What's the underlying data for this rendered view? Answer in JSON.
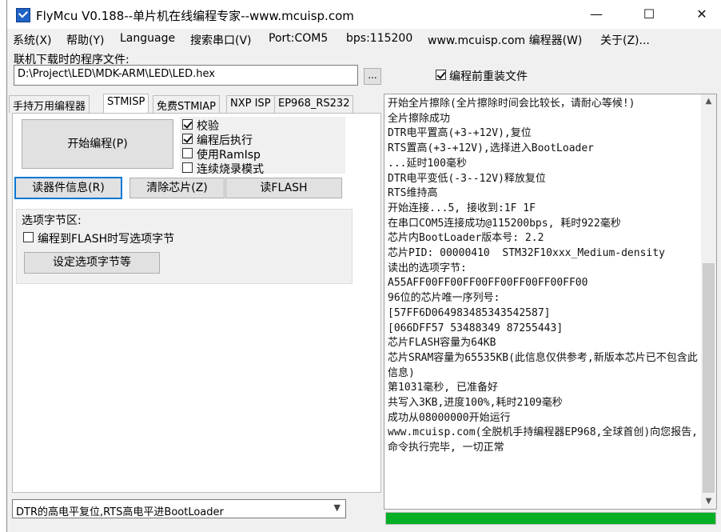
{
  "titlebar": {
    "title": "FlyMcu V0.188--单片机在线编程专家--www.mcuisp.com",
    "minimize": "—",
    "maximize": "☐",
    "close": "✕"
  },
  "menu": [
    "系统(X)",
    "帮助(Y)",
    "Language",
    "搜索串口(V)",
    "Port:COM5",
    "bps:115200",
    "www.mcuisp.com 编程器(W)",
    "关于(Z)..."
  ],
  "file": {
    "label": "联机下载时的程序文件:",
    "path": "D:\\Project\\LED\\MDK-ARM\\LED\\LED.hex",
    "browse": "...",
    "reload_label": "编程前重装文件",
    "reload_checked": true
  },
  "tabs": [
    "手持万用编程器",
    "STMISP",
    "免费STMIAP",
    "NXP ISP",
    "EP968_RS232"
  ],
  "stmisp": {
    "start_button": "开始编程(P)",
    "options": [
      {
        "label": "校验",
        "checked": true
      },
      {
        "label": "编程后执行",
        "checked": true
      },
      {
        "label": "使用RamIsp",
        "checked": false
      },
      {
        "label": "连续烧录模式",
        "checked": false
      }
    ],
    "read_info_button": "读器件信息(R)",
    "erase_button": "清除芯片(Z)",
    "read_flash_button": "读FLASH",
    "option_bytes": {
      "title": "选项字节区:",
      "write_label": "编程到FLASH时写选项字节",
      "write_checked": false,
      "set_button": "设定选项字节等"
    }
  },
  "log": [
    "开始全片擦除(全片擦除时间会比较长，请耐心等候!)",
    "全片擦除成功",
    "DTR电平置高(+3-+12V),复位",
    "RTS置高(+3-+12V),选择进入BootLoader",
    "...延时100毫秒",
    "DTR电平变低(-3--12V)释放复位",
    "RTS维持高",
    "开始连接...5, 接收到:1F 1F",
    "在串口COM5连接成功@115200bps, 耗时922毫秒",
    "芯片内BootLoader版本号: 2.2",
    "芯片PID: 00000410  STM32F10xxx_Medium-density",
    "读出的选项字节:",
    "A55AFF00FF00FF00FF00FF00FF00FF00",
    "96位的芯片唯一序列号:",
    "[57FF6D064983485343542587]",
    "[066DFF57 53488349 87255443]",
    "芯片FLASH容量为64KB",
    "芯片SRAM容量为65535KB(此信息仅供参考,新版本芯片已不包含此信息)",
    "第1031毫秒, 已准备好",
    "共写入3KB,进度100%,耗时2109毫秒",
    "成功从08000000开始运行",
    "www.mcuisp.com(全脱机手持编程器EP968,全球首创)向您报告, 命令执行完毕, 一切正常"
  ],
  "progress_percent": 100,
  "reset_mode": "DTR的高电平复位,RTS高电平进BootLoader",
  "colors": {
    "progress": "#06b025",
    "focus": "#0078d7"
  }
}
